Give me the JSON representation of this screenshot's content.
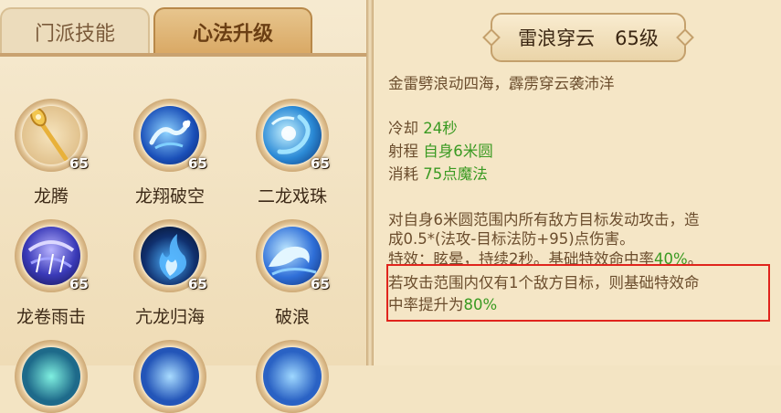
{
  "tabs": [
    {
      "label": "门派技能",
      "active": false
    },
    {
      "label": "心法升级",
      "active": true
    }
  ],
  "skills": [
    {
      "name": "龙腾",
      "level": "65",
      "icon": "golden-staff-icon",
      "theme": "gold"
    },
    {
      "name": "龙翔破空",
      "level": "65",
      "icon": "blue-dragon-icon",
      "theme": "blue"
    },
    {
      "name": "二龙戏珠",
      "level": "65",
      "icon": "twin-dragon-pearl-icon",
      "theme": "cyan"
    },
    {
      "name": "龙卷雨击",
      "level": "65",
      "icon": "storm-rain-icon",
      "theme": "purple"
    },
    {
      "name": "亢龙归海",
      "level": "65",
      "icon": "blue-flame-icon",
      "theme": "dark"
    },
    {
      "name": "破浪",
      "level": "65",
      "icon": "wave-icon",
      "theme": "blue"
    }
  ],
  "detail": {
    "name": "雷浪穿云",
    "level": "65级",
    "description": "金雷劈浪动四海，霹雳穿云袭沛洋",
    "cooldown_label": "冷却",
    "cooldown_value": "24秒",
    "range_label": "射程",
    "range_value": "自身6米圆",
    "cost_label": "消耗",
    "cost_value": "75点魔法",
    "effect_line1": "对自身6米圆范围内所有敌方目标发动攻击，造",
    "effect_line2": "成0.5*(法攻-目标法防+95)点伤害。",
    "special_label": "特效：眩晕，持续2秒。基础特效命中率",
    "special_rate": "40%",
    "special_end": "。",
    "bonus_line1": "若攻击范围内仅有1个敌方目标，则基础特效命",
    "bonus_line2_prefix": "中率提升为",
    "bonus_rate": "80%"
  },
  "colors": {
    "accent_green": "#3a9a22",
    "highlight_red": "#e0241c",
    "text_brown": "#6b4d2d"
  }
}
